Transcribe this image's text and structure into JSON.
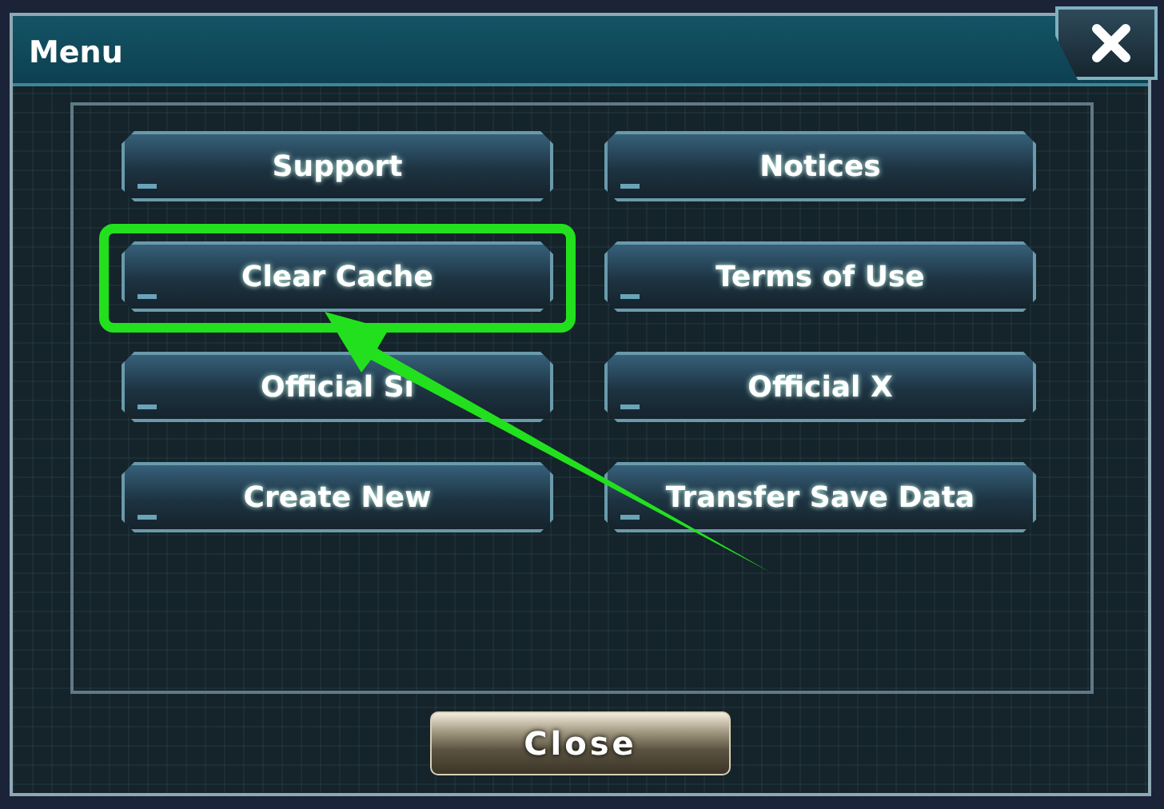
{
  "window": {
    "title": "Menu"
  },
  "buttons": [
    {
      "label": "Support",
      "highlighted": false
    },
    {
      "label": "Notices",
      "highlighted": false
    },
    {
      "label": "Clear Cache",
      "highlighted": true
    },
    {
      "label": "Terms of Use",
      "highlighted": false
    },
    {
      "label": "Official Si",
      "highlighted": false
    },
    {
      "label": "Official X",
      "highlighted": false
    },
    {
      "label": "Create New",
      "highlighted": false
    },
    {
      "label": "Transfer Save Data",
      "highlighted": false
    }
  ],
  "footer_button": {
    "label": "Close"
  }
}
